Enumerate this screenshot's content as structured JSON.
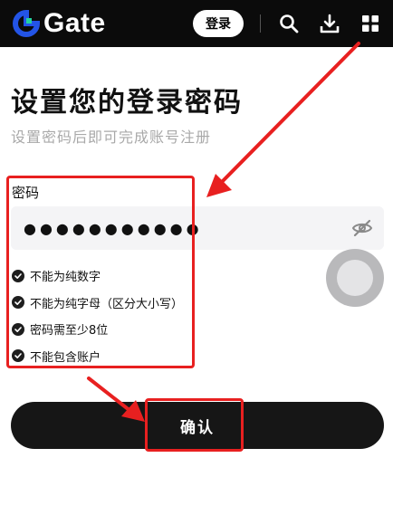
{
  "header": {
    "logo_text": "Gate",
    "login_label": "登录",
    "icons": [
      "search-icon",
      "download-icon",
      "grid-icon"
    ]
  },
  "page": {
    "title": "设置您的登录密码",
    "subtitle": "设置密码后即可完成账号注册"
  },
  "password": {
    "label": "密码",
    "value": "●●●●●●●●●●●",
    "visibility_icon": "eye-off-icon"
  },
  "rules": [
    {
      "text": "不能为纯数字"
    },
    {
      "text": "不能为纯字母（区分大小写）"
    },
    {
      "text": "密码需至少8位"
    },
    {
      "text": "不能包含账户"
    }
  ],
  "confirm_label": "确认",
  "colors": {
    "header_bg": "#0b0b0b",
    "accent_blue": "#2354e6",
    "highlight_red": "#e82020",
    "button_dark": "#161616",
    "muted_text": "#a9a9a9"
  }
}
